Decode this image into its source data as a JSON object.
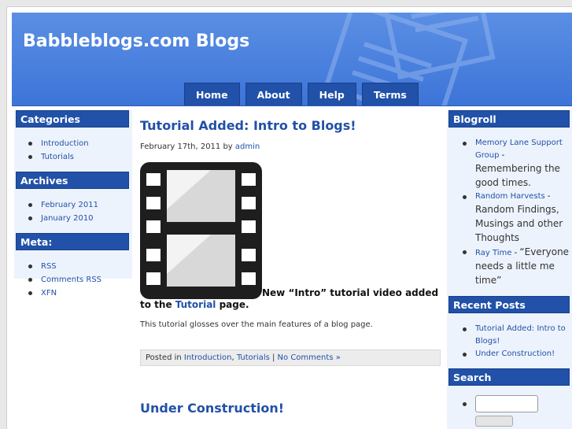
{
  "site": {
    "title": "Babbleblogs.com Blogs"
  },
  "nav": [
    "Home",
    "About",
    "Help",
    "Terms"
  ],
  "left": {
    "categories": {
      "title": "Categories",
      "items": [
        "Introduction",
        "Tutorials"
      ]
    },
    "archives": {
      "title": "Archives",
      "items": [
        "February 2011",
        "January 2010"
      ]
    },
    "meta": {
      "title": "Meta:",
      "items": [
        "RSS",
        "Comments RSS",
        "XFN"
      ]
    }
  },
  "post1": {
    "title": "Tutorial Added: Intro to Blogs!",
    "date": "February 17th, 2011 by ",
    "author": "admin",
    "body_a": "New “Intro” tutorial video added to the ",
    "body_link": "Tutorial",
    "body_b": " page.",
    "para": "This tutorial glosses over the main features of a blog page.",
    "posted_in": "Posted in ",
    "cat1": "Introduction",
    "sep": ", ",
    "cat2": "Tutorials",
    "pipe": " | ",
    "comments": "No Comments »"
  },
  "post2": {
    "title": "Under Construction!"
  },
  "right": {
    "blogroll": {
      "title": "Blogroll",
      "items": [
        {
          "link": "Memory Lane Support Group",
          "sep": " - ",
          "desc": "Remembering the good times."
        },
        {
          "link": "Random Harvests",
          "sep": " - ",
          "desc": "Random Findings, Musings and other Thoughts"
        },
        {
          "link": "Ray Time",
          "sep": " - ",
          "desc": "“Everyone needs a little me time”"
        }
      ]
    },
    "recent": {
      "title": "Recent Posts",
      "items": [
        "Tutorial Added: Intro to Blogs!",
        "Under Construction!"
      ]
    },
    "search": {
      "title": "Search",
      "value": ""
    }
  },
  "colors": {
    "header": "#3d74d8",
    "nav": "#2151a8",
    "sidebar": "#edf3fc",
    "link": "#2151a8"
  },
  "icons": {
    "post_image": "film-strip-icon",
    "header_decoration": "documents-icon"
  }
}
